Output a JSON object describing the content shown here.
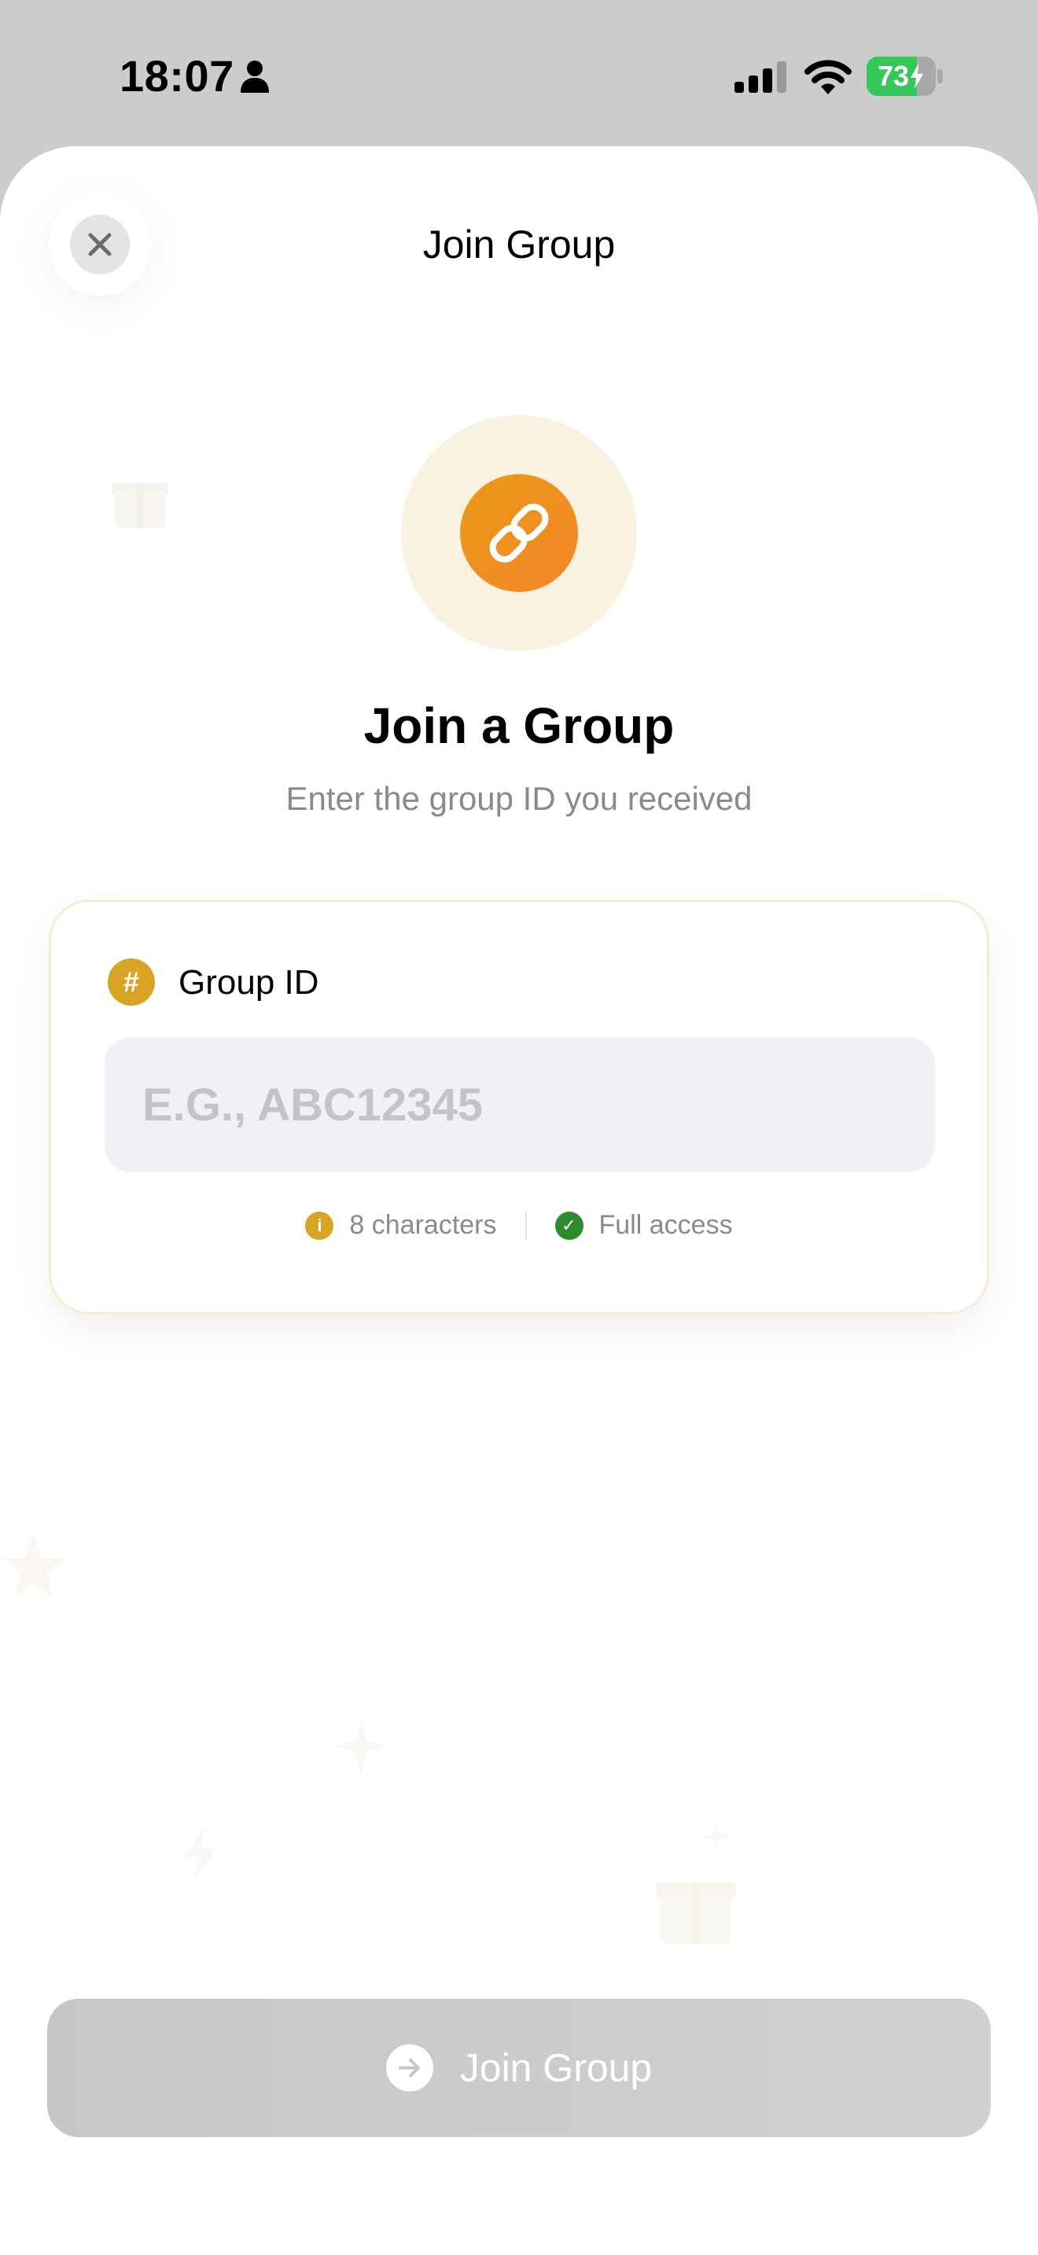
{
  "status_bar": {
    "time": "18:07",
    "battery_percent": "73",
    "battery_level": 0.73,
    "icons": [
      "person-icon",
      "cellular-signal-icon",
      "wifi-icon",
      "battery-charging-icon"
    ]
  },
  "header": {
    "title": "Join Group",
    "close_icon": "close-icon"
  },
  "hero": {
    "icon": "link-icon",
    "title": "Join a Group",
    "subtitle": "Enter the group ID you received"
  },
  "group_card": {
    "badge_icon": "#",
    "label": "Group ID",
    "input_value": "",
    "input_placeholder": "E.G., ABC12345",
    "hints": [
      {
        "icon": "i",
        "icon_name": "info-icon",
        "text": "8 characters",
        "color": "#d8a424"
      },
      {
        "icon": "✓",
        "icon_name": "check-icon",
        "text": "Full access",
        "color": "#2e8b2e"
      }
    ]
  },
  "footer": {
    "join_label": "Join Group",
    "join_icon": "arrow-right-icon"
  },
  "colors": {
    "accent": "#e99a16",
    "accent_soft": "#faf2e0",
    "badge": "#d8a424",
    "success": "#2e8b2e",
    "battery": "#34c759",
    "button_disabled": "#c7c7c9"
  }
}
